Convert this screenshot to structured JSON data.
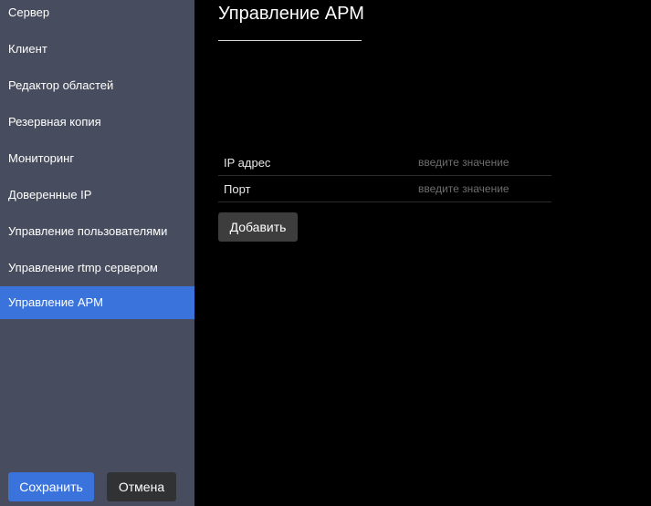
{
  "sidebar": {
    "items": [
      {
        "label": "Сервер",
        "active": false
      },
      {
        "label": "Клиент",
        "active": false
      },
      {
        "label": "Редактор областей",
        "active": false
      },
      {
        "label": "Резервная копия",
        "active": false
      },
      {
        "label": "Мониторинг",
        "active": false
      },
      {
        "label": "Доверенные IP",
        "active": false
      },
      {
        "label": "Управление пользователями",
        "active": false
      },
      {
        "label": "Управление rtmp сервером",
        "active": false
      },
      {
        "label": "Управление АРМ",
        "active": true
      }
    ],
    "save_label": "Сохранить",
    "cancel_label": "Отмена"
  },
  "main": {
    "title": "Управление АРМ",
    "fields": [
      {
        "label": "IP адрес",
        "value": "",
        "placeholder": "введите значение"
      },
      {
        "label": "Порт",
        "value": "",
        "placeholder": "введите значение"
      }
    ],
    "add_label": "Добавить"
  },
  "colors": {
    "sidebar_bg": "#474d5e",
    "accent": "#3a73dc",
    "main_bg": "#000000",
    "cancel_bg": "#313234",
    "add_bg": "#3d3d3d"
  }
}
